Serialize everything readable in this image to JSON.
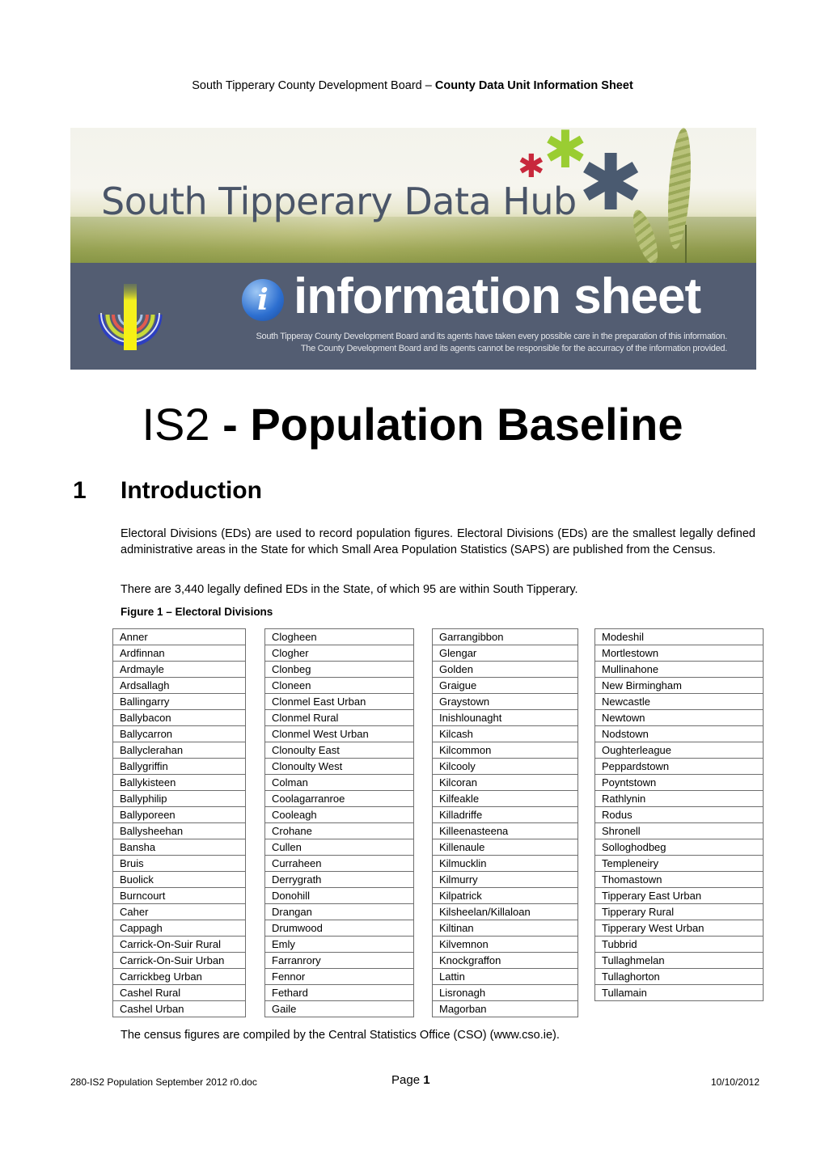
{
  "header": {
    "org": "South Tipperary County Development Board – ",
    "unit": "County Data Unit Information Sheet"
  },
  "banner": {
    "hub_title": "South Tipperary Data Hub",
    "info_glyph": "i",
    "info_title": "information sheet",
    "disclaimer_line1": "South Tipperay County Development Board and its agents have taken every possible care in the preparation of this information.",
    "disclaimer_line2": "The County Development Board and its agents cannot be responsible for the accurracy of the information provided.",
    "colors": {
      "navy": "#535d72",
      "red": "#c8283c",
      "green": "#9acd32",
      "slate": "#4a5a70"
    }
  },
  "title": {
    "code": "IS2",
    "sep": " - ",
    "name": "Population Baseline"
  },
  "section": {
    "number": "1",
    "title": "Introduction"
  },
  "paragraphs": {
    "p1": "Electoral Divisions (EDs) are used to record population figures. Electoral Divisions (EDs) are the smallest legally defined administrative areas in the State for which Small Area Population Statistics (SAPS) are published from the Census.",
    "p2": "There are 3,440 legally defined EDs in the State, of which 95 are within South Tipperary.",
    "p3": "The census figures are compiled by the Central Statistics Office (CSO) (www.cso.ie)."
  },
  "figure": {
    "caption": "Figure 1 – Electoral Divisions",
    "columns": [
      [
        "Anner",
        "Ardfinnan",
        "Ardmayle",
        "Ardsallagh",
        "Ballingarry",
        "Ballybacon",
        "Ballycarron",
        "Ballyclerahan",
        "Ballygriffin",
        "Ballykisteen",
        "Ballyphilip",
        "Ballyporeen",
        "Ballysheehan",
        "Bansha",
        "Bruis",
        "Buolick",
        "Burncourt",
        "Caher",
        "Cappagh",
        "Carrick-On-Suir Rural",
        "Carrick-On-Suir Urban",
        "Carrickbeg Urban",
        "Cashel Rural",
        "Cashel Urban"
      ],
      [
        "Clogheen",
        "Clogher",
        "Clonbeg",
        "Cloneen",
        "Clonmel East Urban",
        "Clonmel Rural",
        "Clonmel West Urban",
        "Clonoulty East",
        "Clonoulty West",
        "Colman",
        "Coolagarranroe",
        "Cooleagh",
        "Crohane",
        "Cullen",
        "Curraheen",
        "Derrygrath",
        "Donohill",
        "Drangan",
        "Drumwood",
        "Emly",
        "Farranrory",
        "Fennor",
        "Fethard",
        "Gaile"
      ],
      [
        "Garrangibbon",
        "Glengar",
        "Golden",
        "Graigue",
        "Graystown",
        "Inishlounaght",
        "Kilcash",
        "Kilcommon",
        "Kilcooly",
        "Kilcoran",
        "Kilfeakle",
        "Killadriffe",
        "Killeenasteena",
        "Killenaule",
        "Kilmucklin",
        "Kilmurry",
        "Kilpatrick",
        "Kilsheelan/Killaloan",
        "Kiltinan",
        "Kilvemnon",
        "Knockgraffon",
        "Lattin",
        "Lisronagh",
        "Magorban"
      ],
      [
        "Modeshil",
        "Mortlestown",
        "Mullinahone",
        "New Birmingham",
        "Newcastle",
        "Newtown",
        "Nodstown",
        "Oughterleague",
        "Peppardstown",
        "Poyntstown",
        "Rathlynin",
        "Rodus",
        "Shronell",
        "Solloghodbeg",
        "Templeneiry",
        "Thomastown",
        "Tipperary East Urban",
        "Tipperary Rural",
        "Tipperary West Urban",
        "Tubbrid",
        "Tullaghmelan",
        "Tullaghorton",
        "Tullamain"
      ]
    ]
  },
  "footer": {
    "filename": "280-IS2 Population September 2012 r0.doc",
    "page_label": "Page ",
    "page_number": "1",
    "date": "10/10/2012"
  }
}
